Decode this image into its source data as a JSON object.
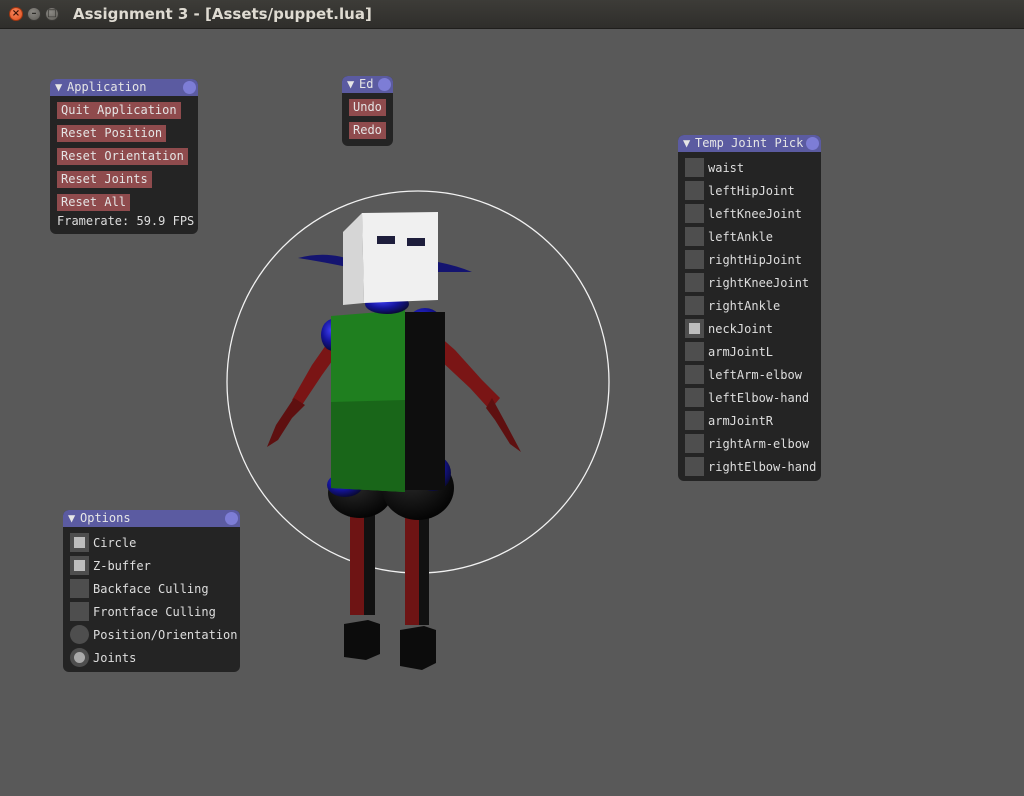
{
  "window": {
    "title": "Assignment 3 - [Assets/puppet.lua]"
  },
  "application_panel": {
    "title": "Application",
    "buttons": [
      "Quit Application",
      "Reset Position",
      "Reset Orientation",
      "Reset Joints",
      "Reset All"
    ],
    "framerate": "Framerate: 59.9 FPS"
  },
  "edit_panel": {
    "title": "Ed",
    "buttons": [
      "Undo",
      "Redo"
    ]
  },
  "joint_panel": {
    "title": "Temp Joint Pick",
    "joints": [
      {
        "label": "waist",
        "checked": false
      },
      {
        "label": "leftHipJoint",
        "checked": false
      },
      {
        "label": "leftKneeJoint",
        "checked": false
      },
      {
        "label": "leftAnkle",
        "checked": false
      },
      {
        "label": "rightHipJoint",
        "checked": false
      },
      {
        "label": "rightKneeJoint",
        "checked": false
      },
      {
        "label": "rightAnkle",
        "checked": false
      },
      {
        "label": "neckJoint",
        "checked": true
      },
      {
        "label": "armJointL",
        "checked": false
      },
      {
        "label": "leftArm-elbow",
        "checked": false
      },
      {
        "label": "leftElbow-hand",
        "checked": false
      },
      {
        "label": "armJointR",
        "checked": false
      },
      {
        "label": "rightArm-elbow",
        "checked": false
      },
      {
        "label": "rightElbow-hand",
        "checked": false
      }
    ]
  },
  "options_panel": {
    "title": "Options",
    "checkboxes": [
      {
        "label": "Circle",
        "checked": true
      },
      {
        "label": "Z-buffer",
        "checked": true
      },
      {
        "label": "Backface Culling",
        "checked": false
      },
      {
        "label": "Frontface Culling",
        "checked": false
      }
    ],
    "radios": [
      {
        "label": "Position/Orientation",
        "selected": false
      },
      {
        "label": "Joints",
        "selected": true
      }
    ]
  },
  "colors": {
    "background": "#595959",
    "panel_header": "#5b5ba1",
    "button": "#8f4b4d",
    "torso": "#1d7a1d",
    "limb_red": "#7a1515",
    "joint_blue": "#1c1ca8",
    "head": "#f0f0f0"
  }
}
